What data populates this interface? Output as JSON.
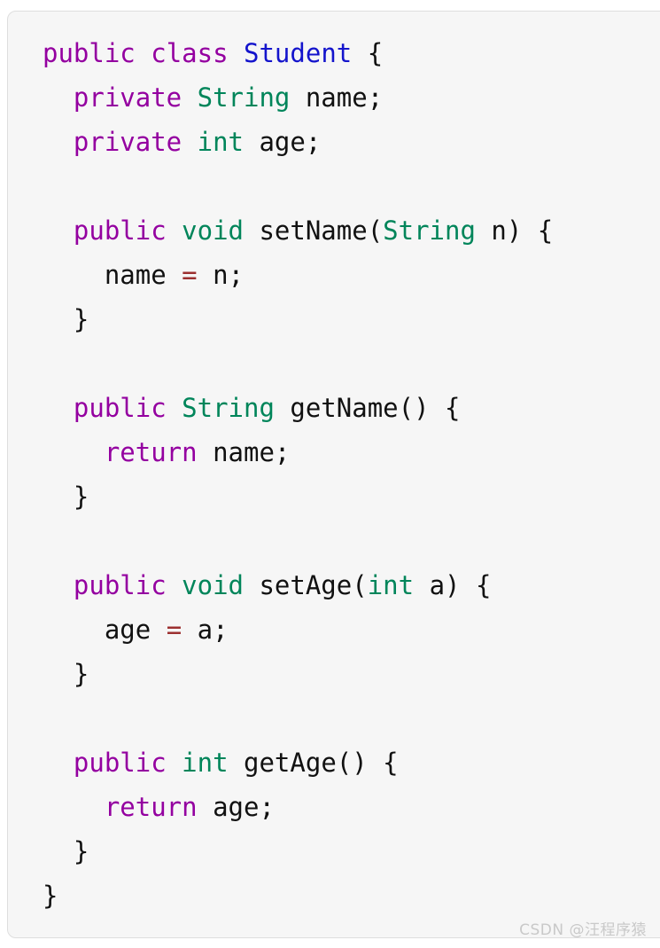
{
  "card": {
    "background_color": "#f6f6f6",
    "border_color": "#dedede",
    "language": "java"
  },
  "theme": {
    "keyword_color": "#9400a0",
    "type_color": "#00855a",
    "class_color": "#1414cc",
    "identifier_color": "#111111",
    "punctuation_color": "#111111",
    "operator_color": "#9c3030",
    "watermark_color": "#c9c9c9"
  },
  "watermark": {
    "text": "CSDN @汪程序猿"
  },
  "code": {
    "plain_text": "public class Student {\n  private String name;\n  private int age;\n\n  public void setName(String n) {\n    name = n;\n  }\n\n  public String getName() {\n    return name;\n  }\n\n  public void setAge(int a) {\n    age = a;\n  }\n\n  public int getAge() {\n    return age;\n  }\n}",
    "lines": [
      {
        "tokens": [
          {
            "text": "public",
            "kind": "keyword"
          },
          {
            "text": " ",
            "kind": "plain"
          },
          {
            "text": "class",
            "kind": "keyword"
          },
          {
            "text": " ",
            "kind": "plain"
          },
          {
            "text": "Student",
            "kind": "class"
          },
          {
            "text": " ",
            "kind": "plain"
          },
          {
            "text": "{",
            "kind": "punct"
          }
        ]
      },
      {
        "tokens": [
          {
            "text": "  ",
            "kind": "plain"
          },
          {
            "text": "private",
            "kind": "keyword"
          },
          {
            "text": " ",
            "kind": "plain"
          },
          {
            "text": "String",
            "kind": "type"
          },
          {
            "text": " ",
            "kind": "plain"
          },
          {
            "text": "name",
            "kind": "ident"
          },
          {
            "text": ";",
            "kind": "punct"
          }
        ]
      },
      {
        "tokens": [
          {
            "text": "  ",
            "kind": "plain"
          },
          {
            "text": "private",
            "kind": "keyword"
          },
          {
            "text": " ",
            "kind": "plain"
          },
          {
            "text": "int",
            "kind": "type"
          },
          {
            "text": " ",
            "kind": "plain"
          },
          {
            "text": "age",
            "kind": "ident"
          },
          {
            "text": ";",
            "kind": "punct"
          }
        ]
      },
      {
        "tokens": []
      },
      {
        "tokens": [
          {
            "text": "  ",
            "kind": "plain"
          },
          {
            "text": "public",
            "kind": "keyword"
          },
          {
            "text": " ",
            "kind": "plain"
          },
          {
            "text": "void",
            "kind": "type"
          },
          {
            "text": " ",
            "kind": "plain"
          },
          {
            "text": "setName",
            "kind": "ident"
          },
          {
            "text": "(",
            "kind": "punct"
          },
          {
            "text": "String",
            "kind": "type"
          },
          {
            "text": " ",
            "kind": "plain"
          },
          {
            "text": "n",
            "kind": "ident"
          },
          {
            "text": ") ",
            "kind": "punct"
          },
          {
            "text": "{",
            "kind": "punct"
          }
        ]
      },
      {
        "tokens": [
          {
            "text": "    ",
            "kind": "plain"
          },
          {
            "text": "name",
            "kind": "ident"
          },
          {
            "text": " ",
            "kind": "plain"
          },
          {
            "text": "=",
            "kind": "operator"
          },
          {
            "text": " ",
            "kind": "plain"
          },
          {
            "text": "n",
            "kind": "ident"
          },
          {
            "text": ";",
            "kind": "punct"
          }
        ]
      },
      {
        "tokens": [
          {
            "text": "  ",
            "kind": "plain"
          },
          {
            "text": "}",
            "kind": "punct"
          }
        ]
      },
      {
        "tokens": []
      },
      {
        "tokens": [
          {
            "text": "  ",
            "kind": "plain"
          },
          {
            "text": "public",
            "kind": "keyword"
          },
          {
            "text": " ",
            "kind": "plain"
          },
          {
            "text": "String",
            "kind": "type"
          },
          {
            "text": " ",
            "kind": "plain"
          },
          {
            "text": "getName",
            "kind": "ident"
          },
          {
            "text": "() ",
            "kind": "punct"
          },
          {
            "text": "{",
            "kind": "punct"
          }
        ]
      },
      {
        "tokens": [
          {
            "text": "    ",
            "kind": "plain"
          },
          {
            "text": "return",
            "kind": "keyword"
          },
          {
            "text": " ",
            "kind": "plain"
          },
          {
            "text": "name",
            "kind": "ident"
          },
          {
            "text": ";",
            "kind": "punct"
          }
        ]
      },
      {
        "tokens": [
          {
            "text": "  ",
            "kind": "plain"
          },
          {
            "text": "}",
            "kind": "punct"
          }
        ]
      },
      {
        "tokens": []
      },
      {
        "tokens": [
          {
            "text": "  ",
            "kind": "plain"
          },
          {
            "text": "public",
            "kind": "keyword"
          },
          {
            "text": " ",
            "kind": "plain"
          },
          {
            "text": "void",
            "kind": "type"
          },
          {
            "text": " ",
            "kind": "plain"
          },
          {
            "text": "setAge",
            "kind": "ident"
          },
          {
            "text": "(",
            "kind": "punct"
          },
          {
            "text": "int",
            "kind": "type"
          },
          {
            "text": " ",
            "kind": "plain"
          },
          {
            "text": "a",
            "kind": "ident"
          },
          {
            "text": ") ",
            "kind": "punct"
          },
          {
            "text": "{",
            "kind": "punct"
          }
        ]
      },
      {
        "tokens": [
          {
            "text": "    ",
            "kind": "plain"
          },
          {
            "text": "age",
            "kind": "ident"
          },
          {
            "text": " ",
            "kind": "plain"
          },
          {
            "text": "=",
            "kind": "operator"
          },
          {
            "text": " ",
            "kind": "plain"
          },
          {
            "text": "a",
            "kind": "ident"
          },
          {
            "text": ";",
            "kind": "punct"
          }
        ]
      },
      {
        "tokens": [
          {
            "text": "  ",
            "kind": "plain"
          },
          {
            "text": "}",
            "kind": "punct"
          }
        ]
      },
      {
        "tokens": []
      },
      {
        "tokens": [
          {
            "text": "  ",
            "kind": "plain"
          },
          {
            "text": "public",
            "kind": "keyword"
          },
          {
            "text": " ",
            "kind": "plain"
          },
          {
            "text": "int",
            "kind": "type"
          },
          {
            "text": " ",
            "kind": "plain"
          },
          {
            "text": "getAge",
            "kind": "ident"
          },
          {
            "text": "() ",
            "kind": "punct"
          },
          {
            "text": "{",
            "kind": "punct"
          }
        ]
      },
      {
        "tokens": [
          {
            "text": "    ",
            "kind": "plain"
          },
          {
            "text": "return",
            "kind": "keyword"
          },
          {
            "text": " ",
            "kind": "plain"
          },
          {
            "text": "age",
            "kind": "ident"
          },
          {
            "text": ";",
            "kind": "punct"
          }
        ]
      },
      {
        "tokens": [
          {
            "text": "  ",
            "kind": "plain"
          },
          {
            "text": "}",
            "kind": "punct"
          }
        ]
      },
      {
        "tokens": [
          {
            "text": "}",
            "kind": "punct"
          }
        ]
      }
    ]
  }
}
